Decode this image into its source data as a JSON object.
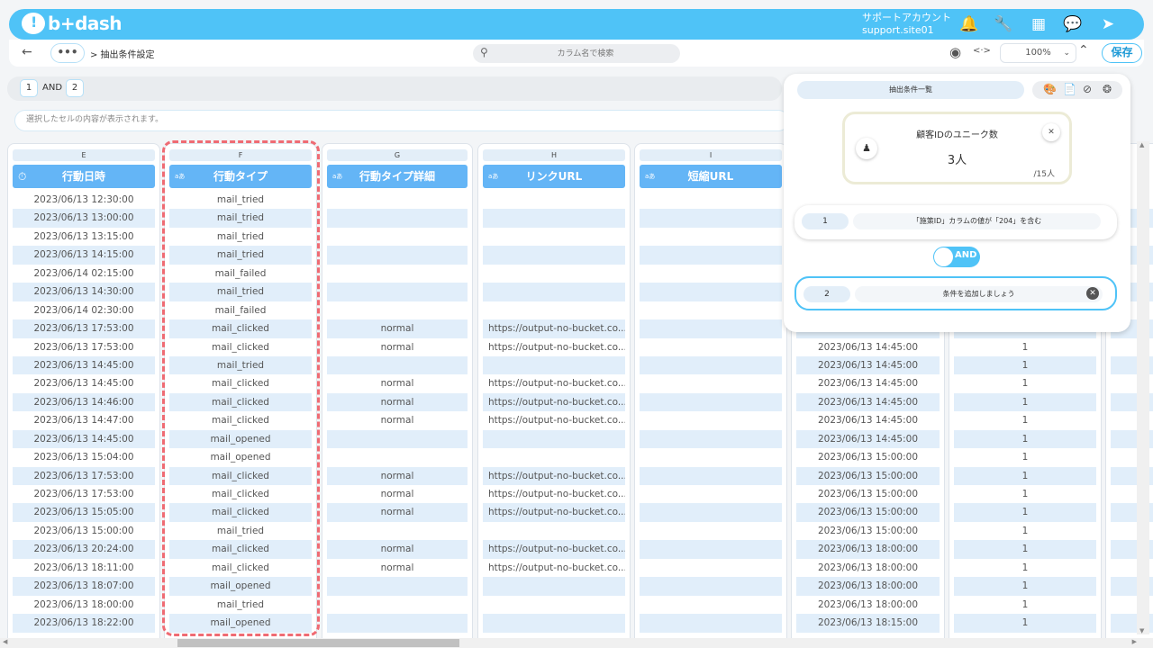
{
  "app": {
    "logo_text": "b+dash"
  },
  "account": {
    "line1": "サポートアカウント",
    "line2": "support.site01"
  },
  "header_icons": [
    "bell-icon",
    "wrench-icon",
    "apps-grid-icon",
    "chat-bubble-icon",
    "logout-icon"
  ],
  "toolbar": {
    "back": "←",
    "more": "•••",
    "breadcrumb": "> 抽出条件設定",
    "search_placeholder": "カラム名で検索",
    "zoom": "100%",
    "save_label": "保存"
  },
  "condition_strip": {
    "chip1": "1",
    "operator": "AND",
    "chip2": "2"
  },
  "cell_view": {
    "placeholder": "選択したセルの内容が表示されます。"
  },
  "columns": [
    {
      "letter": "E",
      "header": "行動日時",
      "type_icon": "clock-icon"
    },
    {
      "letter": "F",
      "header": "行動タイプ",
      "type_icon": "text-type-icon"
    },
    {
      "letter": "G",
      "header": "行動タイプ詳細",
      "type_icon": "text-type-icon"
    },
    {
      "letter": "H",
      "header": "リンクURL",
      "type_icon": "text-type-icon"
    },
    {
      "letter": "I",
      "header": "短縮URL",
      "type_icon": "text-type-icon"
    }
  ],
  "type_glyph": "aあ",
  "rows": {
    "datetime": [
      "2023/06/13 12:30:00",
      "2023/06/13 13:00:00",
      "2023/06/13 13:15:00",
      "2023/06/13 14:15:00",
      "2023/06/14 02:15:00",
      "2023/06/13 14:30:00",
      "2023/06/14 02:30:00",
      "2023/06/13 17:53:00",
      "2023/06/13 17:53:00",
      "2023/06/13 14:45:00",
      "2023/06/13 14:45:00",
      "2023/06/13 14:46:00",
      "2023/06/13 14:47:00",
      "2023/06/13 14:45:00",
      "2023/06/13 15:04:00",
      "2023/06/13 17:53:00",
      "2023/06/13 17:53:00",
      "2023/06/13 15:05:00",
      "2023/06/13 15:00:00",
      "2023/06/13 20:24:00",
      "2023/06/13 18:11:00",
      "2023/06/13 18:07:00",
      "2023/06/13 18:00:00",
      "2023/06/13 18:22:00"
    ],
    "action_type": [
      "mail_tried",
      "mail_tried",
      "mail_tried",
      "mail_tried",
      "mail_failed",
      "mail_tried",
      "mail_failed",
      "mail_clicked",
      "mail_clicked",
      "mail_tried",
      "mail_clicked",
      "mail_clicked",
      "mail_clicked",
      "mail_opened",
      "mail_opened",
      "mail_clicked",
      "mail_clicked",
      "mail_clicked",
      "mail_tried",
      "mail_clicked",
      "mail_clicked",
      "mail_opened",
      "mail_tried",
      "mail_opened"
    ],
    "action_detail": [
      "",
      "",
      "",
      "",
      "",
      "",
      "",
      "normal",
      "normal",
      "",
      "normal",
      "normal",
      "normal",
      "",
      "",
      "normal",
      "normal",
      "normal",
      "",
      "normal",
      "normal",
      "",
      "",
      ""
    ],
    "link_url": [
      "",
      "",
      "",
      "",
      "",
      "",
      "",
      "https://output-no-bucket.co...",
      "https://output-no-bucket.co...",
      "",
      "https://output-no-bucket.co...",
      "https://output-no-bucket.co...",
      "https://output-no-bucket.co...",
      "",
      "",
      "https://output-no-bucket.co...",
      "https://output-no-bucket.co...",
      "https://output-no-bucket.co...",
      "",
      "https://output-no-bucket.co...",
      "https://output-no-bucket.co...",
      "",
      "",
      ""
    ],
    "short_url": [
      "",
      "",
      "",
      "",
      "",
      "",
      "",
      "",
      "",
      "",
      "",
      "",
      "",
      "",
      "",
      "",
      "",
      "",
      "",
      "",
      "",
      "",
      "",
      ""
    ],
    "datetime2": [
      "",
      "",
      "",
      "",
      "",
      "",
      "",
      "",
      "2023/06/13 14:45:00",
      "2023/06/13 14:45:00",
      "2023/06/13 14:45:00",
      "2023/06/13 14:45:00",
      "2023/06/13 14:45:00",
      "2023/06/13 14:45:00",
      "2023/06/13 15:00:00",
      "2023/06/13 15:00:00",
      "2023/06/13 15:00:00",
      "2023/06/13 15:00:00",
      "2023/06/13 15:00:00",
      "2023/06/13 18:00:00",
      "2023/06/13 18:00:00",
      "2023/06/13 18:00:00",
      "2023/06/13 18:00:00",
      "2023/06/13 18:15:00"
    ],
    "count": [
      "",
      "",
      "",
      "",
      "",
      "",
      "",
      "",
      "1",
      "1",
      "1",
      "1",
      "1",
      "1",
      "1",
      "1",
      "1",
      "1",
      "1",
      "1",
      "1",
      "1",
      "1",
      "1"
    ]
  },
  "panel": {
    "title": "抽出条件一覧",
    "icons": [
      "paint-icon",
      "document-icon",
      "eye-off-icon",
      "dots-circle-icon"
    ],
    "card_title": "顧客IDのユニーク数",
    "card_value": "3人",
    "card_total": "/15人",
    "conditions": [
      {
        "num": "1",
        "text": "「施策ID」カラムの値が「204」を含む"
      },
      {
        "num": "2",
        "text": "条件を追加しましょう"
      }
    ],
    "operator": "AND"
  }
}
